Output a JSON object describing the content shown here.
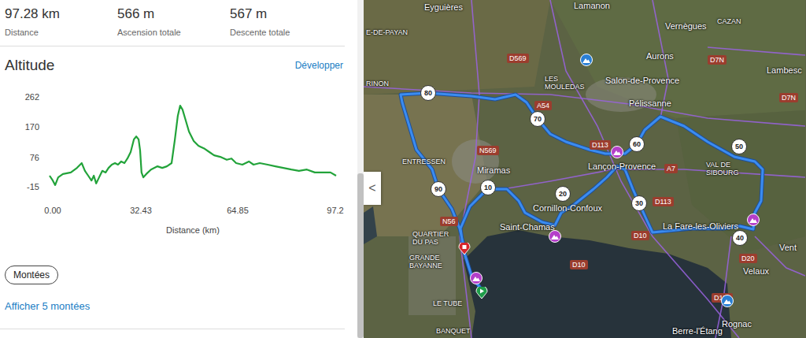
{
  "summary": [
    {
      "value": "97.28 km",
      "label": "Distance"
    },
    {
      "value": "566 m",
      "label": "Ascension totale"
    },
    {
      "value": "567 m",
      "label": "Descente totale"
    }
  ],
  "altitude": {
    "title": "Altitude",
    "expand_link": "Développer",
    "y_ticks": [
      "262",
      "170",
      "76",
      "-15"
    ],
    "x_ticks": [
      "0.00",
      "32.43",
      "64.85",
      "97.2"
    ],
    "x_axis_title": "Distance (km)",
    "series": [
      {
        "name": "elevation",
        "distance_km": [
          0,
          1.1,
          1.9,
          2.9,
          4.5,
          7.2,
          9.3,
          10.9,
          12.0,
          13.1,
          14.2,
          15.0,
          15.8,
          16.8,
          17.9,
          19.0,
          20.0,
          21.1,
          22.2,
          23.2,
          24.3,
          25.4,
          26.4,
          27.5,
          28.6,
          29.4,
          30.2,
          30.7,
          31.2,
          31.8,
          32.8,
          34.4,
          36.6,
          38.2,
          39.8,
          41.4,
          42.5,
          43.5,
          44.3,
          45.1,
          46.2,
          47.3,
          48.9,
          50.5,
          52.6,
          54.2,
          55.8,
          57.9,
          60.1,
          61.7,
          63.3,
          65.4,
          67.6,
          69.2,
          71.3,
          74.0,
          76.6,
          79.3,
          82.0,
          84.6,
          87.3,
          90.0,
          92.7,
          95.3,
          97.2
        ],
        "elevation_m": [
          19,
          4,
          -10,
          14,
          24,
          29,
          43,
          58,
          34,
          19,
          4,
          19,
          -5,
          14,
          34,
          29,
          43,
          53,
          58,
          53,
          63,
          58,
          72,
          92,
          131,
          140,
          131,
          97,
          29,
          14,
          24,
          38,
          48,
          43,
          48,
          58,
          131,
          204,
          235,
          223,
          189,
          155,
          126,
          111,
          102,
          92,
          82,
          77,
          68,
          72,
          58,
          53,
          63,
          53,
          58,
          53,
          48,
          43,
          38,
          34,
          38,
          29,
          29,
          29,
          19
        ]
      }
    ]
  },
  "climbs": {
    "button": "Montées",
    "link": "Afficher 5 montées"
  },
  "collapse_button": "<",
  "map": {
    "labels": [
      {
        "text": "Eyguières",
        "kind": "place"
      },
      {
        "text": "Lamanon",
        "kind": "place"
      },
      {
        "text": "Vernègues",
        "kind": "place"
      },
      {
        "text": "CAZAN",
        "kind": "district"
      },
      {
        "text": "D7N",
        "kind": "road"
      },
      {
        "text": "Aurons",
        "kind": "place"
      },
      {
        "text": "Lambesc",
        "kind": "place"
      },
      {
        "text": "E-DE-PAYAN",
        "kind": "district"
      },
      {
        "text": "RINON",
        "kind": "district"
      },
      {
        "text": "D569",
        "kind": "road"
      },
      {
        "text": "LES MOULEDAS",
        "kind": "district"
      },
      {
        "text": "Salon-de-Provence",
        "kind": "place"
      },
      {
        "text": "Pélissanne",
        "kind": "place"
      },
      {
        "text": "A54",
        "kind": "road"
      },
      {
        "text": "N569",
        "kind": "road"
      },
      {
        "text": "ENTRESSEN",
        "kind": "district"
      },
      {
        "text": "Miramas",
        "kind": "place"
      },
      {
        "text": "D113",
        "kind": "road"
      },
      {
        "text": "Lançon-Provence",
        "kind": "place"
      },
      {
        "text": "A7",
        "kind": "road"
      },
      {
        "text": "VAL DE SIBOURG",
        "kind": "district"
      },
      {
        "text": "D113",
        "kind": "road"
      },
      {
        "text": "Cornillon-Confoux",
        "kind": "place"
      },
      {
        "text": "Saint-Chamas",
        "kind": "place"
      },
      {
        "text": "D10",
        "kind": "road"
      },
      {
        "text": "La Fare-les-Oliviers",
        "kind": "place"
      },
      {
        "text": "D20",
        "kind": "road"
      },
      {
        "text": "Velaux",
        "kind": "place"
      },
      {
        "text": "D113",
        "kind": "road"
      },
      {
        "text": "Rognac",
        "kind": "place"
      },
      {
        "text": "Berre-l'Étang",
        "kind": "place"
      },
      {
        "text": "N56",
        "kind": "road"
      },
      {
        "text": "QUARTIER DU PAS",
        "kind": "district"
      },
      {
        "text": "GRANDE BAYANNE",
        "kind": "district"
      },
      {
        "text": "LE TUBE",
        "kind": "district"
      },
      {
        "text": "BANQUET",
        "kind": "district"
      },
      {
        "text": "D10",
        "kind": "road"
      },
      {
        "text": "Vent",
        "kind": "place"
      },
      {
        "text": "D7N",
        "kind": "road"
      }
    ],
    "km_markers": [
      "10",
      "20",
      "30",
      "40",
      "50",
      "60",
      "70",
      "80",
      "90"
    ],
    "pins": [
      {
        "kind": "climb"
      },
      {
        "kind": "climb"
      },
      {
        "kind": "climb"
      },
      {
        "kind": "climb"
      },
      {
        "kind": "start"
      },
      {
        "kind": "finish"
      },
      {
        "kind": "poi"
      },
      {
        "kind": "poi"
      }
    ]
  }
}
